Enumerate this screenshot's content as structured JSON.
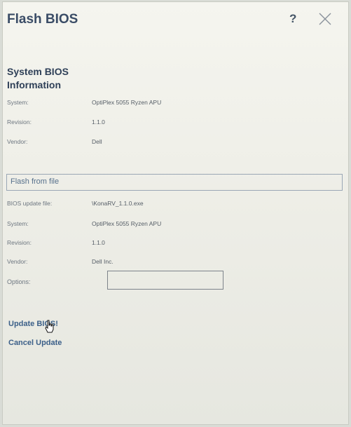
{
  "dialog": {
    "title": "Flash BIOS",
    "help_glyph": "?"
  },
  "system_info": {
    "heading": "System BIOS Information",
    "rows": [
      {
        "label": "System:",
        "value": "OptiPlex 5055 Ryzen APU"
      },
      {
        "label": "Revision:",
        "value": "1.1.0"
      },
      {
        "label": "Vendor:",
        "value": "Dell"
      }
    ]
  },
  "flash_file": {
    "heading": "Flash from file",
    "rows": [
      {
        "label": "BIOS update file:",
        "value": "\\KonaRV_1.1.0.exe"
      },
      {
        "label": "System:",
        "value": "OptiPlex 5055 Ryzen APU"
      },
      {
        "label": "Revision:",
        "value": "1.1.0"
      },
      {
        "label": "Vendor:",
        "value": "Dell Inc."
      }
    ],
    "options_label": "Options:",
    "options_value": ""
  },
  "actions": {
    "update": "Update BIOS!",
    "cancel": "Cancel Update"
  },
  "icons": {
    "close": "close-icon",
    "help": "help-icon",
    "cursor": "hand-pointer-icon"
  }
}
